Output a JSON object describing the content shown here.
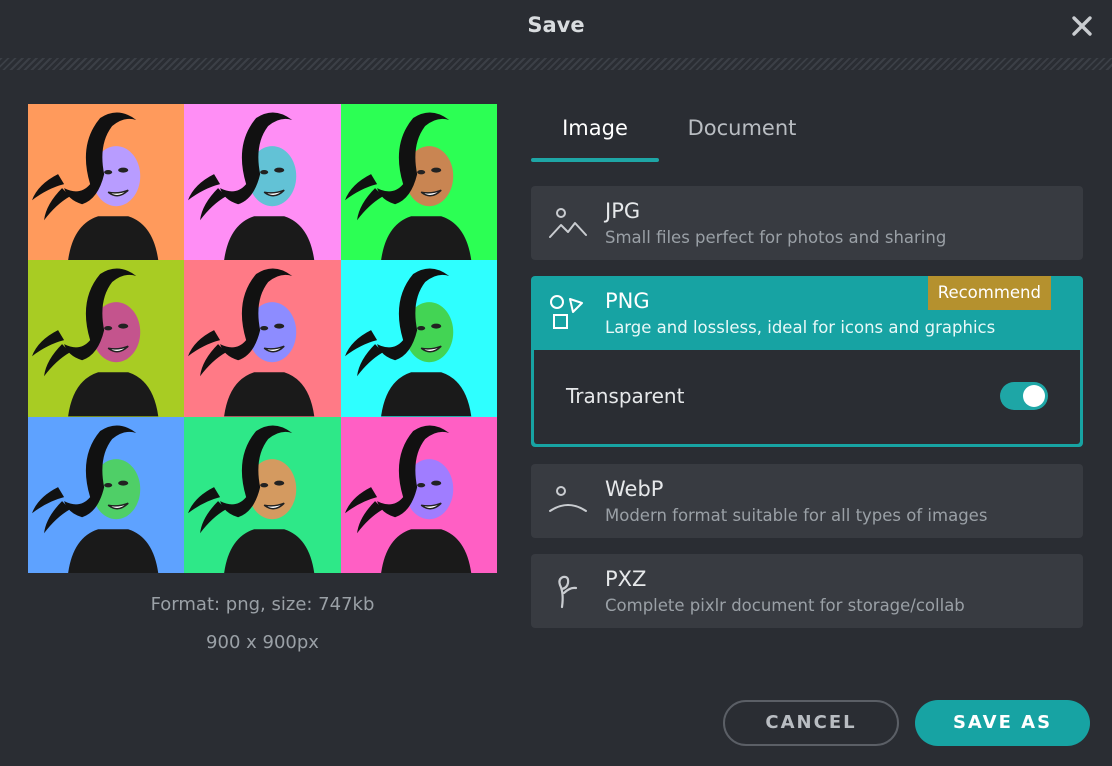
{
  "dialog": {
    "title": "Save"
  },
  "preview": {
    "format_text": "Format: png, size: 747kb",
    "dimensions_text": "900 x 900px",
    "tile_backgrounds": [
      "#ff9a5c",
      "#ff8ef5",
      "#2cff54",
      "#a8cc23",
      "#ff7a86",
      "#2effff",
      "#5ea2ff",
      "#2ee888",
      "#ff5fc4"
    ],
    "tile_faces": [
      "#b89cff",
      "#62c2d6",
      "#c98552",
      "#c4548d",
      "#8d8cff",
      "#43d454",
      "#4fcf67",
      "#d49a60",
      "#a07dff"
    ]
  },
  "tabs": [
    {
      "label": "Image",
      "active": true
    },
    {
      "label": "Document",
      "active": false
    }
  ],
  "options": {
    "jpg": {
      "name": "JPG",
      "description": "Small files perfect for photos and sharing",
      "icon": "image-mountain-icon"
    },
    "png": {
      "name": "PNG",
      "description": "Large and lossless, ideal for icons and graphics",
      "icon": "shapes-icon",
      "badge": "Recommend",
      "selected": true
    },
    "webp": {
      "name": "WebP",
      "description": "Modern format suitable for all types of images",
      "icon": "webp-icon"
    },
    "pxz": {
      "name": "PXZ",
      "description": "Complete pixlr document for storage/collab",
      "icon": "pixlr-icon"
    }
  },
  "transparent": {
    "label": "Transparent",
    "enabled": true
  },
  "buttons": {
    "cancel": "CANCEL",
    "save_as": "SAVE AS"
  },
  "colors": {
    "accent": "#17a3a3",
    "badge": "#b5912e",
    "background": "#2a2d33",
    "card": "#383b41"
  }
}
